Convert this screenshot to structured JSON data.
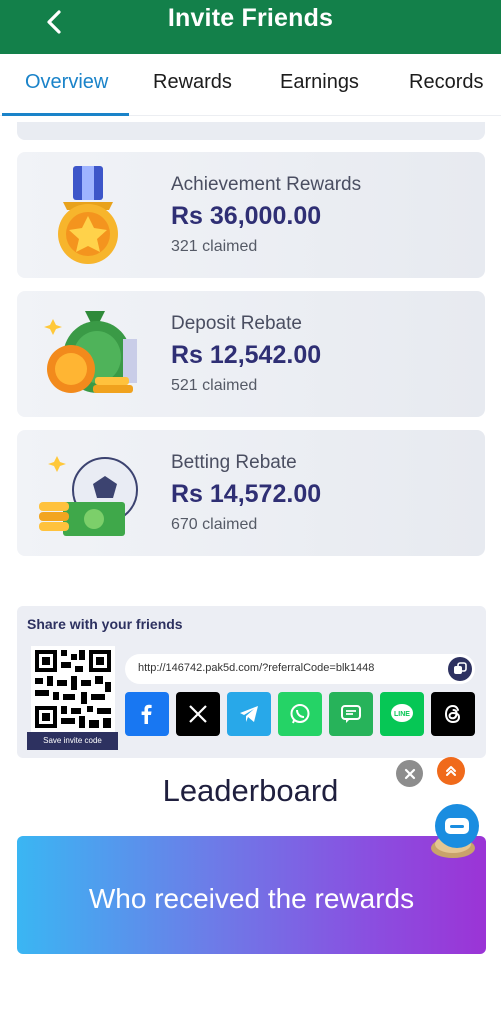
{
  "header": {
    "title": "Invite Friends",
    "back_icon": "chevron-left-icon"
  },
  "tabs": [
    {
      "label": "Overview",
      "active": true
    },
    {
      "label": "Rewards",
      "active": false
    },
    {
      "label": "Earnings",
      "active": false
    },
    {
      "label": "Records",
      "active": false
    }
  ],
  "cards": [
    {
      "icon": "medal-icon",
      "title": "Achievement Rewards",
      "amount": "Rs 36,000.00",
      "claimed": "321 claimed"
    },
    {
      "icon": "money-bag-coins-icon",
      "title": "Deposit Rebate",
      "amount": "Rs 12,542.00",
      "claimed": "521 claimed"
    },
    {
      "icon": "soccer-ball-cash-icon",
      "title": "Betting Rebate",
      "amount": "Rs 14,572.00",
      "claimed": "670 claimed"
    }
  ],
  "share": {
    "title": "Share with your friends",
    "save_label": "Save invite code",
    "link": "http://146742.pak5d.com/?referralCode=blk1448",
    "socials": [
      {
        "name": "facebook",
        "color": "#1877f2"
      },
      {
        "name": "x",
        "color": "#000000"
      },
      {
        "name": "telegram",
        "color": "#28a8e9"
      },
      {
        "name": "whatsapp",
        "color": "#25d366"
      },
      {
        "name": "sms",
        "color": "#27b35a"
      },
      {
        "name": "line",
        "color": "#06c755"
      },
      {
        "name": "threads",
        "color": "#000000"
      }
    ]
  },
  "leaderboard": {
    "title": "Leaderboard"
  },
  "banner": {
    "text": "Who received the rewards"
  },
  "colors": {
    "header_green": "#13804a",
    "tab_active": "#1a83c9",
    "amount_navy": "#2f2f74"
  }
}
